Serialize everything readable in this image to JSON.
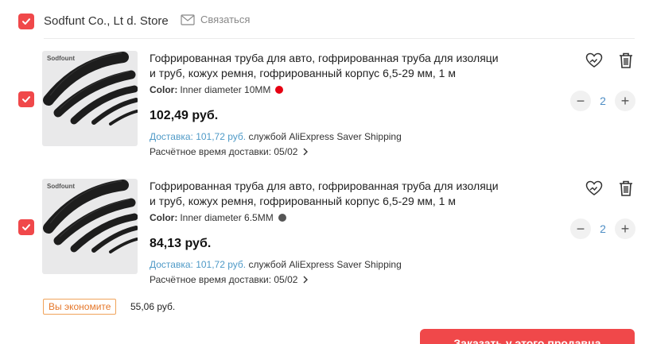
{
  "store": {
    "name": "Sodfunt Co., Lt d. Store",
    "contact_label": "Связаться"
  },
  "items": [
    {
      "brand": "Sodfount",
      "title_line1": "Гофрированная труба для авто, гофрированная труба для изоляци",
      "title_line2": "и труб, кожух ремня, гофрированный корпус 6,5-29 мм, 1 м",
      "color_label": "Color:",
      "color_value": "Inner diameter 10MM",
      "color_dot": "#e60012",
      "price": "102,49 руб.",
      "shipping_fee": "Доставка: 101,72 руб.",
      "shipping_service": "службой AliExpress Saver Shipping",
      "delivery_estimate": "Расчётное время доставки: 05/02",
      "quantity": "2"
    },
    {
      "brand": "Sodfount",
      "title_line1": "Гофрированная труба для авто, гофрированная труба для изоляци",
      "title_line2": "и труб, кожух ремня, гофрированный корпус 6,5-29 мм, 1 м",
      "color_label": "Color:",
      "color_value": "Inner diameter 6.5MM",
      "color_dot": "#555555",
      "price": "84,13 руб.",
      "shipping_fee": "Доставка: 101,72 руб.",
      "shipping_service": "службой AliExpress Saver Shipping",
      "delivery_estimate": "Расчётное время доставки: 05/02",
      "quantity": "2"
    }
  ],
  "savings": {
    "badge": "Вы экономите",
    "amount": "55,06 руб."
  },
  "order_button": "Заказать у этого продавца",
  "accent_color": "#f0484a",
  "icons": [
    "checkbox-checked-icon",
    "mail-icon",
    "heart-icon",
    "trash-icon",
    "minus-icon",
    "plus-icon",
    "chevron-right-icon"
  ]
}
